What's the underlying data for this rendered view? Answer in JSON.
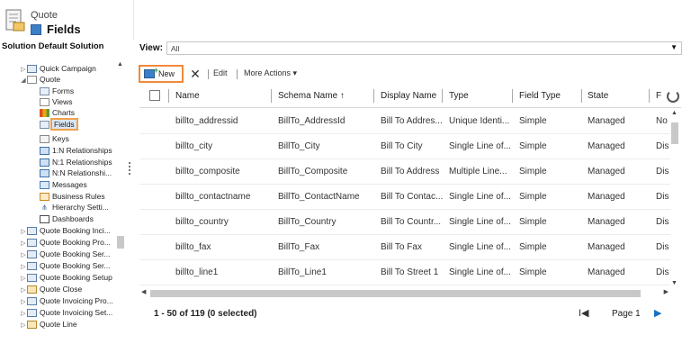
{
  "header": {
    "entity_name": "Quote",
    "page_title": "Fields"
  },
  "solution": {
    "title": "Solution Default Solution"
  },
  "sidebar": {
    "items": [
      {
        "label": "Quick Campaign",
        "icon": "entity-icon"
      },
      {
        "label": "Quote",
        "icon": "entity-icon"
      },
      {
        "label": "Forms",
        "icon": "form-icon"
      },
      {
        "label": "Views",
        "icon": "view-icon"
      },
      {
        "label": "Charts",
        "icon": "chart-icon"
      },
      {
        "label": "Fields",
        "icon": "field-icon"
      },
      {
        "label": "Keys",
        "icon": "key-icon"
      },
      {
        "label": "1:N Relationships",
        "icon": "relationship-icon"
      },
      {
        "label": "N:1 Relationships",
        "icon": "relationship-icon"
      },
      {
        "label": "N:N Relationshi...",
        "icon": "relationship-icon"
      },
      {
        "label": "Messages",
        "icon": "message-icon"
      },
      {
        "label": "Business Rules",
        "icon": "business-rule-icon"
      },
      {
        "label": "Hierarchy Setti...",
        "icon": "hierarchy-icon"
      },
      {
        "label": "Dashboards",
        "icon": "dashboard-icon"
      },
      {
        "label": "Quote Booking Inci...",
        "icon": "entity-icon"
      },
      {
        "label": "Quote Booking Pro...",
        "icon": "entity-icon"
      },
      {
        "label": "Quote Booking Ser...",
        "icon": "entity-icon"
      },
      {
        "label": "Quote Booking Ser...",
        "icon": "entity-icon"
      },
      {
        "label": "Quote Booking Setup",
        "icon": "entity-icon"
      },
      {
        "label": "Quote Close",
        "icon": "entity-icon"
      },
      {
        "label": "Quote Invoicing Pro...",
        "icon": "entity-icon"
      },
      {
        "label": "Quote Invoicing Set...",
        "icon": "entity-icon"
      },
      {
        "label": "Quote Line",
        "icon": "entity-icon"
      }
    ]
  },
  "view": {
    "label": "View:",
    "selected": "All"
  },
  "toolbar": {
    "new_label": "New",
    "delete_glyph": "✕",
    "edit_label": "Edit",
    "more_actions_label": "More Actions ▾"
  },
  "grid": {
    "columns": [
      "Name",
      "Schema Name ↑",
      "Display Name",
      "Type",
      "Field Type",
      "State",
      "F"
    ],
    "rows": [
      [
        "billto_addressid",
        "BillTo_AddressId",
        "Bill To Addres...",
        "Unique Identi...",
        "Simple",
        "Managed",
        "No"
      ],
      [
        "billto_city",
        "BillTo_City",
        "Bill To City",
        "Single Line of...",
        "Simple",
        "Managed",
        "Dis"
      ],
      [
        "billto_composite",
        "BillTo_Composite",
        "Bill To Address",
        "Multiple Line...",
        "Simple",
        "Managed",
        "Dis"
      ],
      [
        "billto_contactname",
        "BillTo_ContactName",
        "Bill To Contac...",
        "Single Line of...",
        "Simple",
        "Managed",
        "Dis"
      ],
      [
        "billto_country",
        "BillTo_Country",
        "Bill To Countr...",
        "Single Line of...",
        "Simple",
        "Managed",
        "Dis"
      ],
      [
        "billto_fax",
        "BillTo_Fax",
        "Bill To Fax",
        "Single Line of...",
        "Simple",
        "Managed",
        "Dis"
      ],
      [
        "billto_line1",
        "BillTo_Line1",
        "Bill To Street 1",
        "Single Line of...",
        "Simple",
        "Managed",
        "Dis"
      ]
    ]
  },
  "footer": {
    "status": "1 - 50 of 119 (0 selected)",
    "page_label": "Page 1",
    "first_glyph": "I◀",
    "next_glyph": "▶"
  },
  "colors": {
    "highlight_border": "#f08a3c",
    "link_blue": "#1a6fc2"
  }
}
